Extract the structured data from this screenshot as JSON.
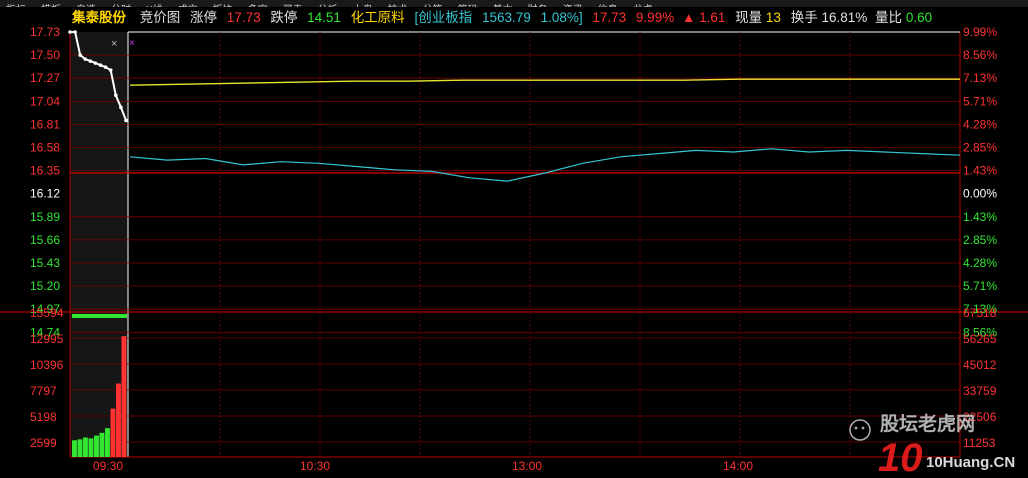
{
  "top_tabs": [
    "指标",
    "模板",
    "自选",
    "分时",
    "K线",
    "成交",
    "板块",
    "多空",
    "买卖",
    "分析",
    "大盘",
    "技术",
    "分笔",
    "筹码",
    "基本",
    "财务",
    "资讯",
    "信息",
    "龙虎"
  ],
  "header": {
    "stock_name": "集泰股份",
    "auction_label": "竞价图",
    "limit_up_label": "涨停",
    "limit_up_value": "17.73",
    "limit_down_label": "跌停",
    "limit_down_value": "14.51",
    "sector": "化工原料",
    "index_name": "[创业板指",
    "index_value": "1563.79",
    "index_change": "1.08%]",
    "price": "17.73",
    "change_pct": "9.99%",
    "change_arrow": "▲",
    "change_value": "1.61",
    "volume_label": "现量",
    "volume_value": "13",
    "turnover_label": "换手",
    "turnover_value": "16.81%",
    "ratio_label": "量比",
    "ratio_value": "0.60"
  },
  "colors": {
    "up": "#ff3232",
    "down": "#32e632",
    "price_line": "#ffffff",
    "avg_line": "#e6e632",
    "index_line": "#36c5d2",
    "grid": "#7a0000"
  },
  "price_axis": {
    "left_labels": [
      "17.73",
      "17.50",
      "17.27",
      "17.04",
      "16.81",
      "16.58",
      "16.35",
      "16.12",
      "15.89",
      "15.66",
      "15.43",
      "15.20",
      "14.97",
      "14.74"
    ],
    "right_labels": [
      "9.99%",
      "8.56%",
      "7.13%",
      "5.71%",
      "4.28%",
      "2.85%",
      "1.43%",
      "0.00%",
      "1.43%",
      "2.85%",
      "4.28%",
      "5.71%",
      "7.13%",
      "8.56%"
    ]
  },
  "volume_axis": {
    "left_labels": [
      "15594",
      "12995",
      "10396",
      "7797",
      "5198",
      "2599"
    ],
    "right_labels": [
      "67518",
      "56265",
      "45012",
      "33759",
      "22506",
      "11253"
    ]
  },
  "time_labels": [
    "09:30",
    "10:30",
    "13:00",
    "14:00"
  ],
  "watermark": {
    "line1": "股坛老虎网",
    "line2": "10Huang.CN"
  },
  "chart_data": {
    "type": "line",
    "series": [
      {
        "values": [
          17.73,
          17.73,
          17.5,
          17.46,
          17.44,
          17.42,
          17.4,
          17.38,
          17.35,
          17.1,
          16.98,
          16.85
        ]
      },
      {
        "values": [
          17.2,
          17.21,
          17.22,
          17.23,
          17.24,
          17.24,
          17.25,
          17.25,
          17.25,
          17.25,
          17.25,
          17.26,
          17.26,
          17.26,
          17.26,
          17.26
        ]
      },
      {
        "values": [
          1.0,
          0.8,
          0.9,
          0.5,
          0.7,
          0.6,
          0.4,
          0.2,
          0.1,
          -0.3,
          -0.5,
          0.0,
          0.6,
          1.0,
          1.2,
          1.4,
          1.3,
          1.5,
          1.3,
          1.4,
          1.3,
          1.2,
          1.1
        ]
      }
    ],
    "volume_values": [
      1800,
      1900,
      2100,
      2000,
      2300,
      2600,
      3100,
      5200,
      7900,
      12995
    ]
  }
}
